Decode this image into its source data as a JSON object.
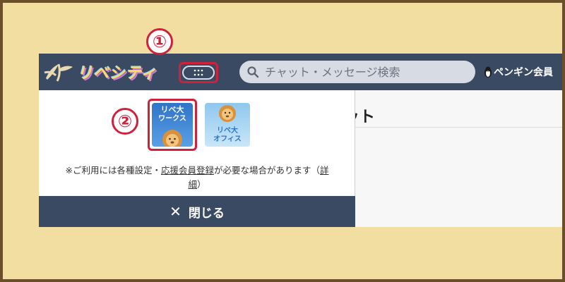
{
  "topbar": {
    "logo_text": "リベシティ",
    "apps_button_label": "apps",
    "search_placeholder": "チャット・メッセージ検索",
    "user_label": "ペンギン会員"
  },
  "behind": {
    "heading_fragment": "ット"
  },
  "dropdown": {
    "apps": [
      {
        "title": "リベ大",
        "subtitle": "ワークス",
        "selected": true
      },
      {
        "title": "リベ大",
        "subtitle": "オフィス",
        "selected": false
      }
    ],
    "notice_prefix": "※ご利用には各種設定・",
    "notice_link1": "応援会員登録",
    "notice_mid": "が必要な場合があります（",
    "notice_link2_part1": "詳",
    "notice_link2_part2": "細",
    "notice_suffix": "）",
    "close_label": "閉じる"
  },
  "markers": {
    "one": "①",
    "two": "②"
  },
  "colors": {
    "background": "#f3dea2",
    "header": "#3b4a63",
    "highlight": "#d0213b"
  }
}
